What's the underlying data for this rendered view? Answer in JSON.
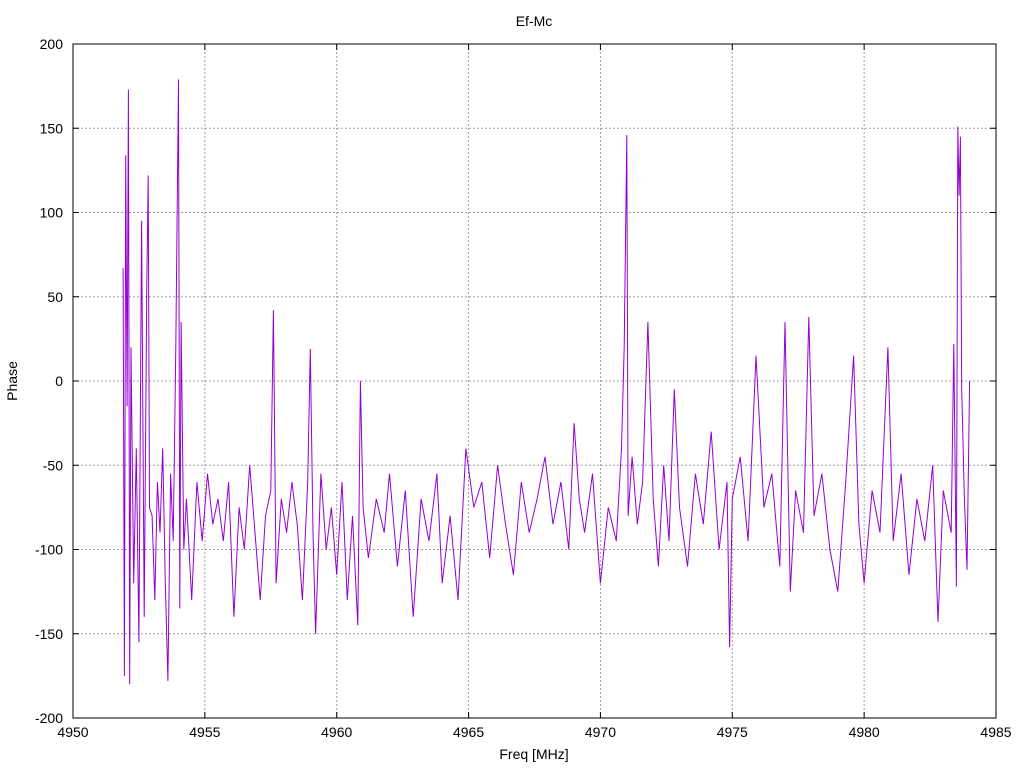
{
  "chart_data": {
    "type": "line",
    "title": "Ef-Mc",
    "xlabel": "Freq [MHz]",
    "ylabel": "Phase",
    "xlim": [
      4950,
      4985
    ],
    "ylim": [
      -200,
      200
    ],
    "xticks": [
      "4950",
      "4955",
      "4960",
      "4965",
      "4970",
      "4975",
      "4980",
      "4985"
    ],
    "yticks": [
      "200",
      "150",
      "100",
      "50",
      "0",
      "-50",
      "-100",
      "-150",
      "-200"
    ],
    "grid": true,
    "legend": "none",
    "colors": {
      "series": "#9400d3",
      "grid": "#a0a0a0",
      "axis": "#000000"
    },
    "series": [
      {
        "x_start": 4951.9,
        "x_end": 4984.0,
        "points": [
          [
            4951.9,
            67
          ],
          [
            4951.95,
            -175
          ],
          [
            4952.0,
            134
          ],
          [
            4952.05,
            -15
          ],
          [
            4952.1,
            173
          ],
          [
            4952.15,
            -180
          ],
          [
            4952.2,
            20
          ],
          [
            4952.3,
            -120
          ],
          [
            4952.4,
            -40
          ],
          [
            4952.5,
            -155
          ],
          [
            4952.6,
            95
          ],
          [
            4952.7,
            -140
          ],
          [
            4952.8,
            58
          ],
          [
            4952.85,
            122
          ],
          [
            4952.9,
            -75
          ],
          [
            4953.0,
            -80
          ],
          [
            4953.1,
            -130
          ],
          [
            4953.2,
            -60
          ],
          [
            4953.3,
            -90
          ],
          [
            4953.4,
            -40
          ],
          [
            4953.5,
            -120
          ],
          [
            4953.6,
            -178
          ],
          [
            4953.7,
            -55
          ],
          [
            4953.8,
            -95
          ],
          [
            4953.9,
            20
          ],
          [
            4954.0,
            179
          ],
          [
            4954.05,
            -135
          ],
          [
            4954.1,
            35
          ],
          [
            4954.2,
            -100
          ],
          [
            4954.3,
            -70
          ],
          [
            4954.5,
            -130
          ],
          [
            4954.7,
            -60
          ],
          [
            4954.9,
            -95
          ],
          [
            4955.1,
            -55
          ],
          [
            4955.3,
            -85
          ],
          [
            4955.5,
            -70
          ],
          [
            4955.7,
            -95
          ],
          [
            4955.9,
            -60
          ],
          [
            4956.1,
            -140
          ],
          [
            4956.3,
            -75
          ],
          [
            4956.5,
            -100
          ],
          [
            4956.7,
            -50
          ],
          [
            4956.9,
            -90
          ],
          [
            4957.1,
            -130
          ],
          [
            4957.3,
            -80
          ],
          [
            4957.5,
            -65
          ],
          [
            4957.6,
            42
          ],
          [
            4957.7,
            -120
          ],
          [
            4957.9,
            -70
          ],
          [
            4958.1,
            -90
          ],
          [
            4958.3,
            -60
          ],
          [
            4958.5,
            -85
          ],
          [
            4958.7,
            -130
          ],
          [
            4958.9,
            -60
          ],
          [
            4959.0,
            19
          ],
          [
            4959.1,
            -90
          ],
          [
            4959.2,
            -150
          ],
          [
            4959.4,
            -55
          ],
          [
            4959.6,
            -100
          ],
          [
            4959.8,
            -75
          ],
          [
            4960.0,
            -115
          ],
          [
            4960.2,
            -60
          ],
          [
            4960.4,
            -130
          ],
          [
            4960.6,
            -80
          ],
          [
            4960.8,
            -145
          ],
          [
            4960.9,
            0
          ],
          [
            4961.0,
            -75
          ],
          [
            4961.2,
            -105
          ],
          [
            4961.5,
            -70
          ],
          [
            4961.8,
            -90
          ],
          [
            4962.0,
            -55
          ],
          [
            4962.3,
            -110
          ],
          [
            4962.6,
            -65
          ],
          [
            4962.9,
            -140
          ],
          [
            4963.2,
            -70
          ],
          [
            4963.5,
            -95
          ],
          [
            4963.8,
            -55
          ],
          [
            4964.0,
            -120
          ],
          [
            4964.3,
            -80
          ],
          [
            4964.6,
            -130
          ],
          [
            4964.9,
            -40
          ],
          [
            4965.2,
            -75
          ],
          [
            4965.5,
            -60
          ],
          [
            4965.8,
            -105
          ],
          [
            4966.1,
            -50
          ],
          [
            4966.4,
            -85
          ],
          [
            4966.7,
            -115
          ],
          [
            4967.0,
            -60
          ],
          [
            4967.3,
            -90
          ],
          [
            4967.6,
            -70
          ],
          [
            4967.9,
            -45
          ],
          [
            4968.2,
            -85
          ],
          [
            4968.5,
            -60
          ],
          [
            4968.8,
            -100
          ],
          [
            4969.0,
            -25
          ],
          [
            4969.2,
            -70
          ],
          [
            4969.4,
            -90
          ],
          [
            4969.7,
            -55
          ],
          [
            4970.0,
            -120
          ],
          [
            4970.3,
            -75
          ],
          [
            4970.6,
            -95
          ],
          [
            4970.8,
            -40
          ],
          [
            4970.9,
            20
          ],
          [
            4971.0,
            146
          ],
          [
            4971.05,
            -80
          ],
          [
            4971.2,
            -45
          ],
          [
            4971.4,
            -85
          ],
          [
            4971.6,
            -60
          ],
          [
            4971.8,
            35
          ],
          [
            4972.0,
            -70
          ],
          [
            4972.2,
            -110
          ],
          [
            4972.4,
            -50
          ],
          [
            4972.6,
            -95
          ],
          [
            4972.8,
            -5
          ],
          [
            4973.0,
            -75
          ],
          [
            4973.3,
            -110
          ],
          [
            4973.6,
            -55
          ],
          [
            4973.9,
            -85
          ],
          [
            4974.2,
            -30
          ],
          [
            4974.5,
            -100
          ],
          [
            4974.8,
            -60
          ],
          [
            4974.9,
            -158
          ],
          [
            4975.0,
            -70
          ],
          [
            4975.3,
            -45
          ],
          [
            4975.6,
            -95
          ],
          [
            4975.9,
            15
          ],
          [
            4976.2,
            -75
          ],
          [
            4976.5,
            -55
          ],
          [
            4976.8,
            -110
          ],
          [
            4977.0,
            35
          ],
          [
            4977.2,
            -125
          ],
          [
            4977.4,
            -65
          ],
          [
            4977.7,
            -90
          ],
          [
            4977.9,
            38
          ],
          [
            4978.1,
            -80
          ],
          [
            4978.4,
            -55
          ],
          [
            4978.7,
            -100
          ],
          [
            4979.0,
            -125
          ],
          [
            4979.3,
            -60
          ],
          [
            4979.6,
            15
          ],
          [
            4979.8,
            -85
          ],
          [
            4980.0,
            -120
          ],
          [
            4980.3,
            -65
          ],
          [
            4980.6,
            -90
          ],
          [
            4980.9,
            20
          ],
          [
            4981.1,
            -95
          ],
          [
            4981.4,
            -55
          ],
          [
            4981.7,
            -115
          ],
          [
            4982.0,
            -70
          ],
          [
            4982.3,
            -95
          ],
          [
            4982.6,
            -50
          ],
          [
            4982.8,
            -143
          ],
          [
            4983.0,
            -65
          ],
          [
            4983.3,
            -90
          ],
          [
            4983.4,
            22
          ],
          [
            4983.5,
            -122
          ],
          [
            4983.55,
            151
          ],
          [
            4983.6,
            110
          ],
          [
            4983.65,
            145
          ],
          [
            4983.7,
            -5
          ],
          [
            4983.8,
            -70
          ],
          [
            4983.9,
            -112
          ],
          [
            4984.0,
            0
          ]
        ]
      }
    ]
  }
}
